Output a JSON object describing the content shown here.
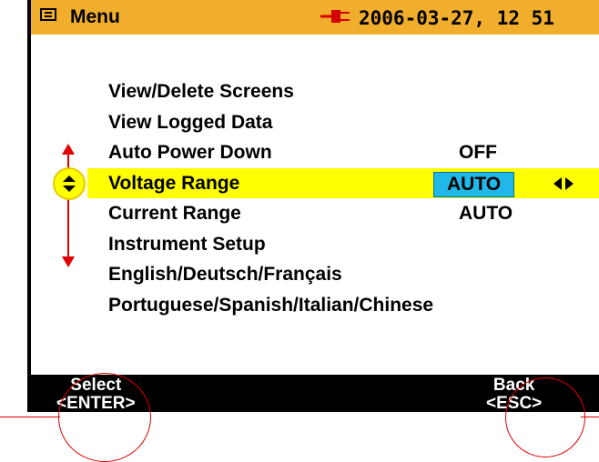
{
  "header": {
    "title": "Menu",
    "datetime": "2006-03-27, 12 51",
    "menu_icon": "list-icon",
    "power_icon": "mains-plug-icon"
  },
  "menu": {
    "items": [
      {
        "label": "View/Delete Screens",
        "value": ""
      },
      {
        "label": "View Logged Data",
        "value": ""
      },
      {
        "label": "Auto Power Down",
        "value": "OFF"
      },
      {
        "label": "Voltage Range",
        "value": "AUTO",
        "selected": true
      },
      {
        "label": "Current Range",
        "value": "AUTO"
      },
      {
        "label": "Instrument Setup",
        "value": ""
      },
      {
        "label": "English/Deutsch/Français",
        "value": ""
      },
      {
        "label": "Portuguese/Spanish/Italian/Chinese",
        "value": ""
      }
    ]
  },
  "softkeys": {
    "left": {
      "top": "Select",
      "bottom": "<ENTER>"
    },
    "right": {
      "top": "Back",
      "bottom": "<ESC>"
    }
  },
  "colors": {
    "title_bar": "#f0ae2c",
    "selection": "#ffff00",
    "value_highlight": "#1fb8e8",
    "annotation": "#e00000",
    "softkey_bar": "#000000"
  }
}
